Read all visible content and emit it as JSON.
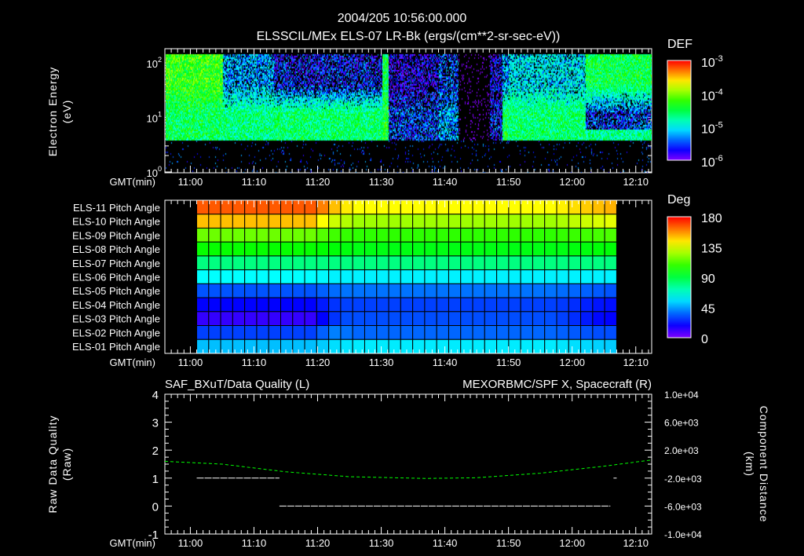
{
  "header": {
    "title": "2004/205 10:56:00.000",
    "subtitle": "ELSSCIL/MEx ELS-07 LR-Bk  (ergs/(cm**2-sr-sec-eV))"
  },
  "time_axis": {
    "label": "GMT(min)",
    "start": "10:56",
    "end": "12:12.5",
    "ticks": [
      "11:00",
      "11:10",
      "11:20",
      "11:30",
      "11:40",
      "11:50",
      "12:00",
      "12:10"
    ]
  },
  "chart_data": [
    {
      "type": "heatmap",
      "name": "electron-spectrogram",
      "ylabel_line1": "Electron Energy",
      "ylabel_line2": "(eV)",
      "yscale": "log",
      "ylim": [
        1,
        182
      ],
      "y_ticks": [
        {
          "value": 1,
          "base": "10",
          "exp": "0"
        },
        {
          "value": 10,
          "base": "10",
          "exp": "1"
        },
        {
          "value": 100,
          "base": "10",
          "exp": "2"
        }
      ],
      "colorbar": {
        "label": "DEF",
        "scale": "log",
        "range_log10": [
          -6,
          -3
        ],
        "ticks": [
          {
            "value": -3,
            "base": "10",
            "exp": "-3"
          },
          {
            "value": -4,
            "base": "10",
            "exp": "-4"
          },
          {
            "value": -5,
            "base": "10",
            "exp": "-5"
          },
          {
            "value": -6,
            "base": "10",
            "exp": "-6"
          }
        ]
      },
      "energy_cutoff_eV": 4,
      "energy_max_eV": 150,
      "segments": [
        {
          "start": "10:56",
          "end": "11:05",
          "low_log10": -4.55,
          "high_log10": -4.25
        },
        {
          "start": "11:05",
          "end": "11:13",
          "low_log10": -4.65,
          "high_log10": -5.3
        },
        {
          "start": "11:13",
          "end": "11:30",
          "low_log10": -4.6,
          "high_log10": -5.6
        },
        {
          "start": "11:30",
          "end": "11:31",
          "low_log10": -4.4,
          "high_log10": -4.5
        },
        {
          "start": "11:31",
          "end": "11:39",
          "low_log10": -5.5,
          "high_log10": -5.75
        },
        {
          "start": "11:39",
          "end": "11:42",
          "low_log10": -5.3,
          "high_log10": -5.5
        },
        {
          "start": "11:42",
          "end": "11:47",
          "low_log10": -6.5,
          "high_log10": -6.5
        },
        {
          "start": "11:47",
          "end": "11:49",
          "low_log10": -5.6,
          "high_log10": -5.7
        },
        {
          "start": "11:49",
          "end": "11:50",
          "low_log10": -4.5,
          "high_log10": -5.3
        },
        {
          "start": "11:50",
          "end": "12:02",
          "low_log10": -4.6,
          "high_log10": -5.1
        },
        {
          "start": "12:02",
          "end": "12:12.5",
          "low_log10": -5.5,
          "high_log10": -4.5,
          "floor_max_eV": 6,
          "floor_log10": -4.7
        }
      ]
    },
    {
      "type": "heatmap",
      "name": "pitch-angle",
      "start": "11:01",
      "end": "12:07",
      "colorbar": {
        "label": "Deg",
        "range": [
          0,
          180
        ],
        "ticks": [
          180,
          135,
          90,
          45,
          0
        ]
      },
      "rows": [
        {
          "label": "ELS-11 Pitch Angle",
          "values": [
            166,
            166,
            166,
            166,
            166,
            166,
            166,
            166,
            166,
            166,
            160,
            150,
            143,
            140,
            140,
            140,
            140,
            140,
            140,
            140,
            140,
            140,
            140,
            140,
            140,
            140,
            140,
            140,
            140,
            140,
            142,
            145,
            148,
            150,
            152
          ]
        },
        {
          "label": "ELS-10 Pitch Angle",
          "values": [
            150,
            150,
            150,
            150,
            150,
            150,
            150,
            150,
            150,
            150,
            140,
            132,
            128,
            125,
            125,
            125,
            125,
            125,
            125,
            125,
            125,
            125,
            125,
            125,
            125,
            125,
            125,
            125,
            125,
            125,
            127,
            130,
            132,
            134,
            136
          ]
        },
        {
          "label": "ELS-09 Pitch Angle",
          "values": [
            117,
            117,
            117,
            117,
            117,
            117,
            117,
            117,
            117,
            117,
            113,
            110,
            108,
            107,
            107,
            107,
            107,
            107,
            107,
            107,
            107,
            107,
            107,
            107,
            107,
            107,
            107,
            107,
            107,
            107,
            108,
            109,
            110,
            111,
            112
          ]
        },
        {
          "label": "ELS-08 Pitch Angle",
          "values": [
            101,
            101,
            101,
            101,
            101,
            101,
            101,
            101,
            101,
            101,
            100,
            99,
            98,
            97,
            97,
            97,
            97,
            97,
            97,
            97,
            97,
            97,
            97,
            97,
            97,
            97,
            97,
            97,
            97,
            97,
            97,
            98,
            98,
            99,
            99
          ]
        },
        {
          "label": "ELS-07 Pitch Angle",
          "values": [
            80,
            80,
            80,
            80,
            80,
            80,
            80,
            80,
            80,
            80,
            80,
            80,
            80,
            80,
            80,
            80,
            80,
            80,
            80,
            80,
            80,
            80,
            80,
            80,
            80,
            80,
            80,
            80,
            80,
            80,
            80,
            80,
            80,
            80,
            80
          ]
        },
        {
          "label": "ELS-06 Pitch Angle",
          "values": [
            60,
            60,
            60,
            60,
            60,
            60,
            60,
            60,
            60,
            60,
            59,
            58,
            58,
            58,
            58,
            58,
            58,
            58,
            58,
            58,
            58,
            58,
            58,
            58,
            58,
            58,
            58,
            58,
            58,
            58,
            58,
            58,
            58,
            58,
            58
          ]
        },
        {
          "label": "ELS-05 Pitch Angle",
          "values": [
            33,
            33,
            33,
            33,
            33,
            33,
            33,
            33,
            33,
            33,
            35,
            37,
            38,
            38,
            38,
            38,
            38,
            38,
            38,
            38,
            38,
            38,
            38,
            38,
            38,
            38,
            38,
            38,
            38,
            38,
            37,
            36,
            35,
            34,
            33
          ]
        },
        {
          "label": "ELS-04 Pitch Angle",
          "values": [
            20,
            20,
            20,
            20,
            20,
            20,
            20,
            20,
            20,
            20,
            24,
            28,
            30,
            30,
            30,
            30,
            30,
            30,
            30,
            30,
            30,
            30,
            30,
            30,
            30,
            30,
            30,
            30,
            30,
            30,
            29,
            27,
            25,
            23,
            22
          ]
        },
        {
          "label": "ELS-03 Pitch Angle",
          "values": [
            12,
            12,
            12,
            12,
            12,
            12,
            12,
            12,
            12,
            12,
            20,
            28,
            32,
            32,
            32,
            32,
            32,
            32,
            32,
            32,
            32,
            32,
            32,
            32,
            32,
            32,
            32,
            32,
            32,
            32,
            30,
            27,
            24,
            21,
            20
          ]
        },
        {
          "label": "ELS-02 Pitch Angle",
          "values": [
            30,
            30,
            30,
            30,
            30,
            30,
            30,
            30,
            30,
            30,
            35,
            40,
            38,
            36,
            36,
            36,
            36,
            36,
            36,
            36,
            36,
            36,
            36,
            36,
            36,
            36,
            36,
            36,
            36,
            36,
            35,
            34,
            33,
            32,
            32
          ]
        },
        {
          "label": "ELS-01 Pitch Angle",
          "values": [
            50,
            50,
            50,
            50,
            50,
            50,
            50,
            50,
            50,
            50,
            52,
            55,
            56,
            57,
            57,
            57,
            57,
            57,
            57,
            57,
            57,
            57,
            57,
            57,
            57,
            57,
            57,
            57,
            57,
            57,
            56,
            55,
            54,
            53,
            52
          ]
        }
      ]
    },
    {
      "type": "line",
      "name": "data-quality-and-position",
      "title_left": "SAF_BXuT/Data Quality (L)",
      "title_right": "MEXORBMC/SPF X, Spacecraft (R)",
      "ylabel_left_line1": "Raw Data Quality",
      "ylabel_left_line2": "(Raw)",
      "ylabel_right_line1": "Component Distance",
      "ylabel_right_line2": "(km)",
      "ylim_left": [
        -1,
        4
      ],
      "ylim_right": [
        -10000,
        10000
      ],
      "left_ticks": [
        "4",
        "3",
        "2",
        "1",
        "0",
        "-1"
      ],
      "left_tick_values": [
        4,
        3,
        2,
        1,
        0,
        -1
      ],
      "right_ticks": [
        "1.0e+04",
        "6.0e+03",
        "2.0e+03",
        "-2.0e+03",
        "-6.0e+03",
        "-1.0e+04"
      ],
      "right_tick_values": [
        10000,
        6000,
        2000,
        -2000,
        -6000,
        -10000
      ],
      "colors": {
        "left": "#ffffff",
        "right": "#00ff00"
      },
      "quality_series": [
        {
          "start": "11:01",
          "end": "11:14",
          "value": 1
        },
        {
          "start": "11:14",
          "end": "12:06",
          "value": 0
        },
        {
          "start": "12:06.5",
          "end": "12:07",
          "value": 1
        }
      ],
      "position_series": {
        "t": [
          "10:56",
          "11:05",
          "11:15",
          "11:25",
          "11:37",
          "11:45",
          "11:55",
          "12:05",
          "12:12.5"
        ],
        "km": [
          400,
          0,
          -1100,
          -1800,
          -2050,
          -1950,
          -1300,
          -300,
          600
        ]
      }
    }
  ]
}
